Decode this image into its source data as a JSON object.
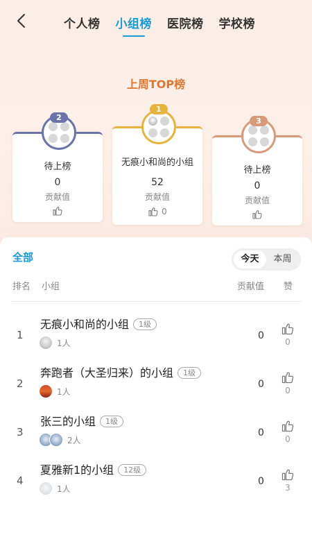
{
  "header": {
    "tabs": [
      {
        "label": "个人榜",
        "active": false
      },
      {
        "label": "小组榜",
        "active": true
      },
      {
        "label": "医院榜",
        "active": false
      },
      {
        "label": "学校榜",
        "active": false
      }
    ]
  },
  "week_title": "上周TOP榜",
  "podium": {
    "second": {
      "rank": "2",
      "name": "待上榜",
      "value": "0",
      "value_label": "贡献值",
      "likes": ""
    },
    "first": {
      "rank": "1",
      "name": "无痕小和尚的小组",
      "value": "52",
      "value_label": "贡献值",
      "likes": "0"
    },
    "third": {
      "rank": "3",
      "name": "待上榜",
      "value": "0",
      "value_label": "贡献值",
      "likes": ""
    }
  },
  "list": {
    "filter_all": "全部",
    "period": {
      "today": "今天",
      "week": "本周",
      "selected": "今天"
    },
    "columns": {
      "rank": "排名",
      "group": "小组",
      "value": "贡献值",
      "likes": "赞"
    },
    "rows": [
      {
        "rank": "1",
        "name": "无痕小和尚的小组",
        "level": "1级",
        "members": "1人",
        "value": "0",
        "likes": "0"
      },
      {
        "rank": "2",
        "name": "奔跑者（大圣归来）的小组",
        "level": "1级",
        "members": "1人",
        "value": "0",
        "likes": "0"
      },
      {
        "rank": "3",
        "name": "张三的小组",
        "level": "1级",
        "members": "2人",
        "value": "0",
        "likes": "0"
      },
      {
        "rank": "4",
        "name": "夏雅新1的小组",
        "level": "12级",
        "members": "1人",
        "value": "0",
        "likes": "3"
      }
    ]
  },
  "colors": {
    "accent": "#1b9ad6",
    "title_orange": "#e2762e",
    "silver": "#6b74a9",
    "gold": "#e6b33c",
    "bronze": "#d99a7a"
  },
  "icons": {
    "back": "chevron-left-icon",
    "like": "thumbs-up-icon"
  }
}
